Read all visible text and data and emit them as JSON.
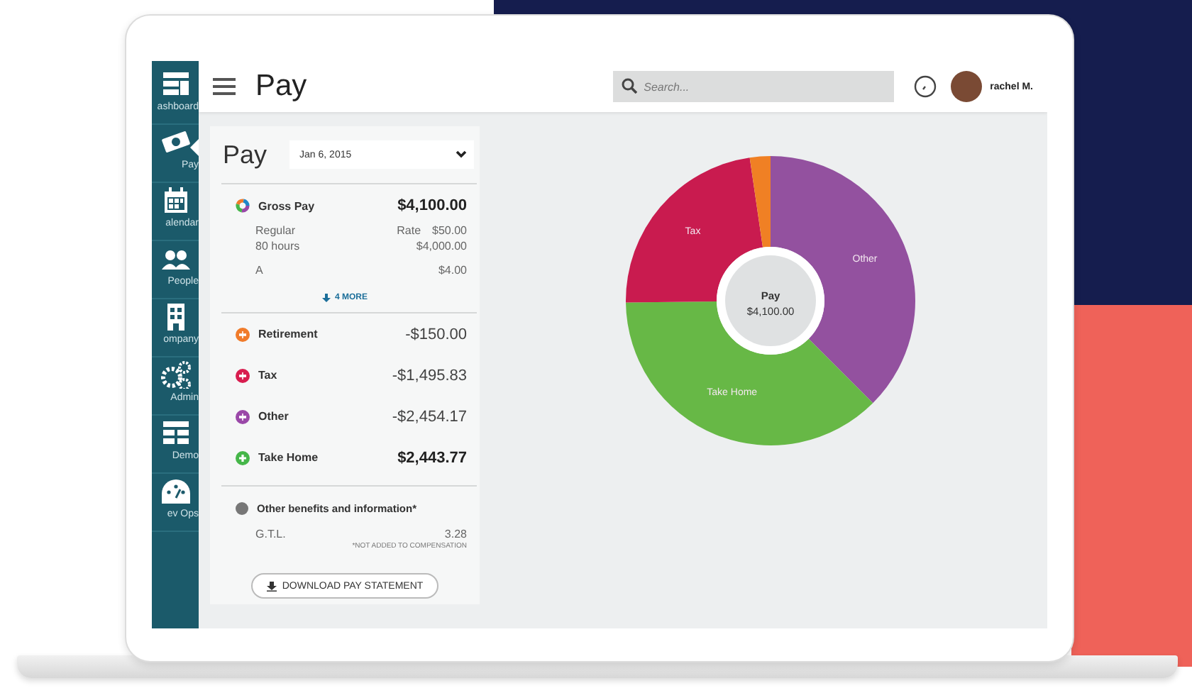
{
  "sidebar": {
    "items": [
      {
        "label": "ashboard",
        "selected": false
      },
      {
        "label": "Pay",
        "selected": true
      },
      {
        "label": "alendar",
        "selected": false
      },
      {
        "label": "People",
        "selected": false
      },
      {
        "label": "ompany",
        "selected": false
      },
      {
        "label": "Admin",
        "selected": false
      },
      {
        "label": "Demo",
        "selected": false
      },
      {
        "label": "ev Ops",
        "selected": false
      }
    ]
  },
  "header": {
    "title": "Pay",
    "search": {
      "placeholder": "Search..."
    },
    "user": {
      "name": "rachel M."
    }
  },
  "pay_card": {
    "title": "Pay",
    "date": "Jan 6, 2015",
    "gross": {
      "label": "Gross Pay",
      "amount": "$4,100.00"
    },
    "details": [
      {
        "label": "Regular",
        "rate_label": "Rate",
        "value": "$50.00"
      },
      {
        "label": "80 hours",
        "value": "$4,000.00"
      },
      {
        "label": "A",
        "value": "$4.00"
      }
    ],
    "more": "4 MORE",
    "items": [
      {
        "label": "Retirement",
        "amount": "-$150.00",
        "color": "#f07b2a",
        "kind": "deduction"
      },
      {
        "label": "Tax",
        "amount": "-$1,495.83",
        "color": "#d81d4f",
        "kind": "deduction"
      },
      {
        "label": "Other",
        "amount": "-$2,454.17",
        "color": "#9a48a8",
        "kind": "deduction"
      },
      {
        "label": "Take Home",
        "amount": "$2,443.77",
        "color": "#45b649",
        "kind": "total"
      }
    ],
    "benefits": {
      "label": "Other benefits and information*",
      "rows": [
        {
          "label": "G.T.L.",
          "value": "3.28"
        }
      ],
      "note": "*NOT ADDED TO COMPENSATION"
    },
    "download_button": "DOWNLOAD PAY STATEMENT"
  },
  "chart": {
    "center_label": "Pay",
    "center_value": "$4,100.00",
    "slices": [
      {
        "label": "Other",
        "color": "#93519f"
      },
      {
        "label": "Take Home",
        "color": "#67b846"
      },
      {
        "label": "Tax",
        "color": "#c91b4f"
      },
      {
        "color": "#f08024"
      }
    ],
    "chart_data": {
      "type": "donut",
      "values": [
        37.5,
        37.3,
        22.9,
        2.3
      ]
    }
  }
}
